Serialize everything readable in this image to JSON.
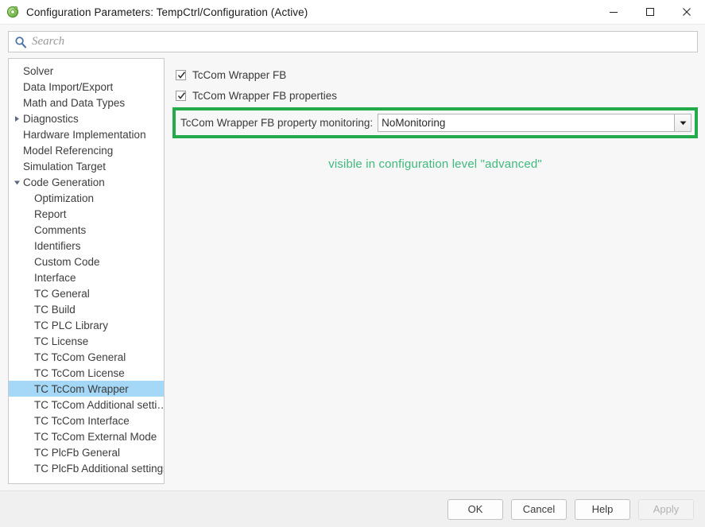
{
  "window": {
    "title": "Configuration Parameters: TempCtrl/Configuration (Active)",
    "app_icon": "simulink-config-icon",
    "minimize_label": "–",
    "maximize_label": "□",
    "close_label": "×"
  },
  "search": {
    "placeholder": "Search",
    "value": "",
    "icon": "search-icon"
  },
  "tree": {
    "items": [
      {
        "label": "Solver",
        "level": 1,
        "arrow": "none",
        "selected": false
      },
      {
        "label": "Data Import/Export",
        "level": 1,
        "arrow": "none",
        "selected": false
      },
      {
        "label": "Math and Data Types",
        "level": 1,
        "arrow": "none",
        "selected": false
      },
      {
        "label": "Diagnostics",
        "level": 1,
        "arrow": "collapsed",
        "selected": false
      },
      {
        "label": "Hardware Implementation",
        "level": 1,
        "arrow": "none",
        "selected": false
      },
      {
        "label": "Model Referencing",
        "level": 1,
        "arrow": "none",
        "selected": false
      },
      {
        "label": "Simulation Target",
        "level": 1,
        "arrow": "none",
        "selected": false
      },
      {
        "label": "Code Generation",
        "level": 1,
        "arrow": "expanded",
        "selected": false
      },
      {
        "label": "Optimization",
        "level": 2,
        "arrow": "none",
        "selected": false
      },
      {
        "label": "Report",
        "level": 2,
        "arrow": "none",
        "selected": false
      },
      {
        "label": "Comments",
        "level": 2,
        "arrow": "none",
        "selected": false
      },
      {
        "label": "Identifiers",
        "level": 2,
        "arrow": "none",
        "selected": false
      },
      {
        "label": "Custom Code",
        "level": 2,
        "arrow": "none",
        "selected": false
      },
      {
        "label": "Interface",
        "level": 2,
        "arrow": "none",
        "selected": false
      },
      {
        "label": "TC General",
        "level": 2,
        "arrow": "none",
        "selected": false
      },
      {
        "label": "TC Build",
        "level": 2,
        "arrow": "none",
        "selected": false
      },
      {
        "label": "TC PLC Library",
        "level": 2,
        "arrow": "none",
        "selected": false
      },
      {
        "label": "TC License",
        "level": 2,
        "arrow": "none",
        "selected": false
      },
      {
        "label": "TC TcCom General",
        "level": 2,
        "arrow": "none",
        "selected": false
      },
      {
        "label": "TC TcCom License",
        "level": 2,
        "arrow": "none",
        "selected": false
      },
      {
        "label": "TC TcCom Wrapper",
        "level": 2,
        "arrow": "none",
        "selected": true
      },
      {
        "label": "TC TcCom Additional setti…",
        "level": 2,
        "arrow": "none",
        "selected": false
      },
      {
        "label": "TC TcCom Interface",
        "level": 2,
        "arrow": "none",
        "selected": false
      },
      {
        "label": "TC TcCom External Mode",
        "level": 2,
        "arrow": "none",
        "selected": false
      },
      {
        "label": "TC PlcFb General",
        "level": 2,
        "arrow": "none",
        "selected": false
      },
      {
        "label": "TC PlcFb Additional settings",
        "level": 2,
        "arrow": "none",
        "selected": false
      }
    ]
  },
  "content": {
    "checkboxes": [
      {
        "label": "TcCom Wrapper FB",
        "checked": true
      },
      {
        "label": "TcCom Wrapper FB properties",
        "checked": true
      }
    ],
    "dropdown": {
      "label": "TcCom Wrapper FB property monitoring:",
      "value": "NoMonitoring",
      "arrow_icon": "chevron-down-icon"
    },
    "annotation": "visible in configuration level \"advanced\""
  },
  "footer": {
    "ok": "OK",
    "cancel": "Cancel",
    "help": "Help",
    "apply": "Apply",
    "apply_enabled": false
  },
  "colors": {
    "highlight_green": "#22aa4b",
    "annotation_green": "#3fb97c",
    "selection_blue": "#a5d8f6"
  }
}
